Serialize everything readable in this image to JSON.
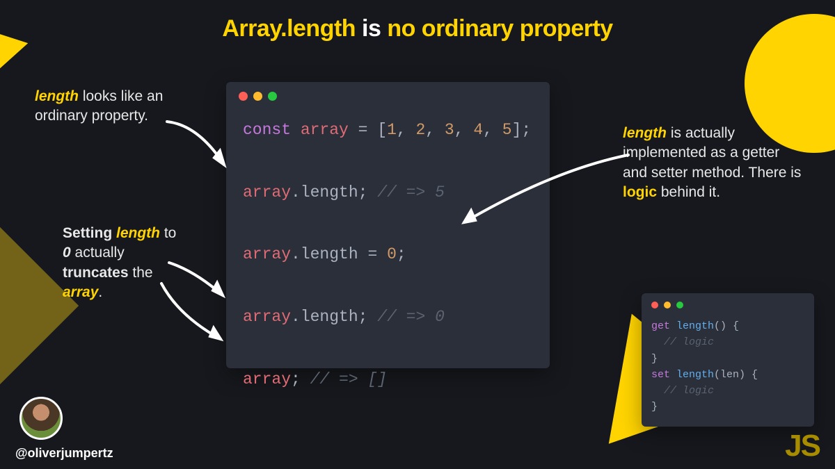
{
  "title": {
    "part1": "Array.length",
    "part2": " is ",
    "part3": "no ordinary property"
  },
  "annotations": {
    "a1_y": "length",
    "a1_rest": " looks like an ordinary property.",
    "a2_pre": "Setting ",
    "a2_y1": "length",
    "a2_mid1": " to ",
    "a2_b1": "0",
    "a2_mid2": " actually ",
    "a2_b2": "truncates",
    "a2_mid3": " the ",
    "a2_y2": "array",
    "a2_end": ".",
    "a3_y1": "length",
    "a3_mid": " is actually implemented as a getter and setter method. There is ",
    "a3_b1": "logic",
    "a3_end": " behind it."
  },
  "code_main": {
    "l1_kw": "const",
    "l1_var": " array ",
    "l1_eq": "= [",
    "l1_n1": "1",
    "l1_c": ", ",
    "l1_n2": "2",
    "l1_n3": "3",
    "l1_n4": "4",
    "l1_n5": "5",
    "l1_end": "];",
    "l2_var": "array",
    "l2_dot": ".",
    "l2_prop": "length",
    "l2_semi": ";",
    "l2_comm": " // => 5",
    "l3_var": "array",
    "l3_dot": ".",
    "l3_prop": "length ",
    "l3_eq": "= ",
    "l3_num": "0",
    "l3_semi": ";",
    "l4_var": "array",
    "l4_dot": ".",
    "l4_prop": "length",
    "l4_semi": ";",
    "l4_comm": " // => 0",
    "l5_var": "array",
    "l5_semi": ";",
    "l5_comm": " // => []"
  },
  "code_small": {
    "l1_kw": "get",
    "l1_fn": " length",
    "l1_p": "() {",
    "l2_comm": "  // logic",
    "l3_close": "}",
    "l4_kw": "set",
    "l4_fn": " length",
    "l4_p": "(len) {",
    "l5_comm": "  // logic",
    "l6_close": "}"
  },
  "footer": {
    "handle": "@oliverjumpertz",
    "js": "JS"
  }
}
